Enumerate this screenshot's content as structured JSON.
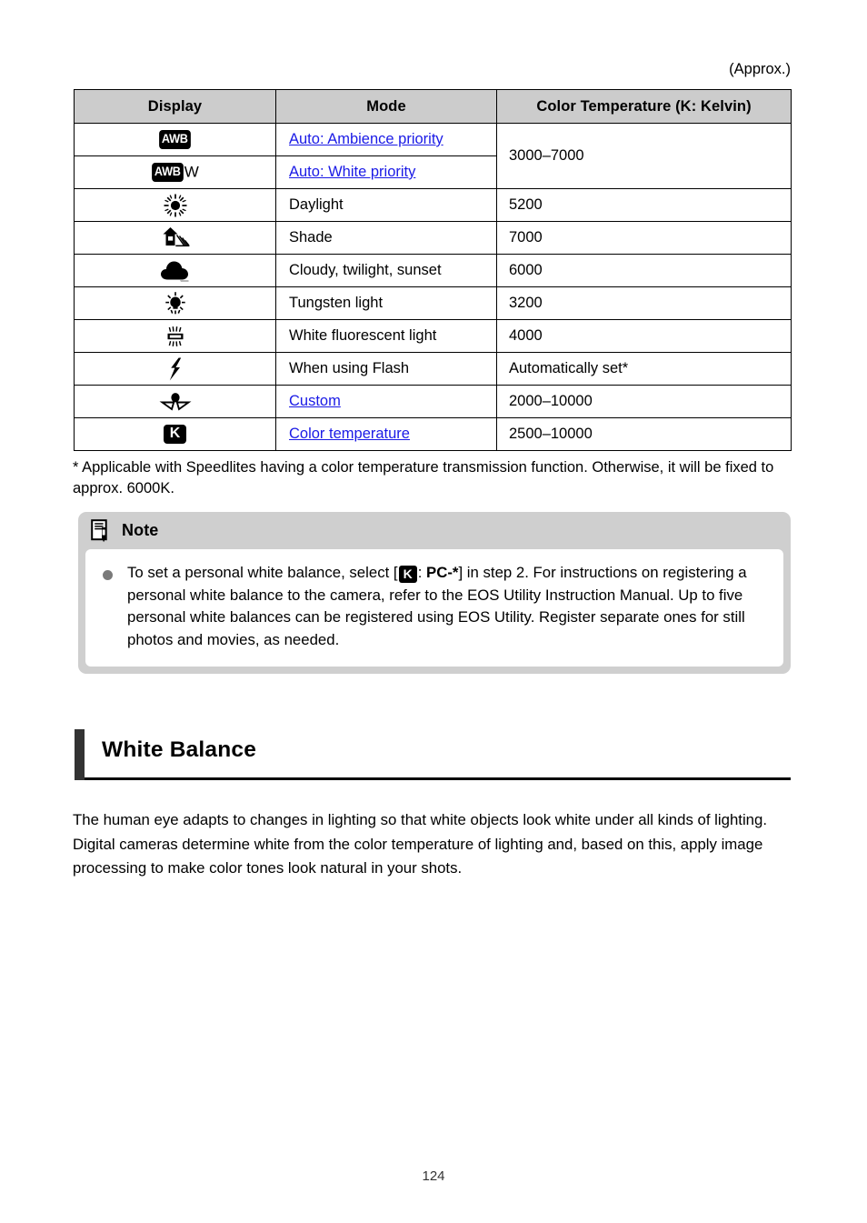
{
  "document": {
    "page_number": "124",
    "approx_label": "(Approx.)"
  },
  "table": {
    "headers": {
      "display": "Display",
      "mode": "Mode",
      "temperature": "Color Temperature (K: Kelvin)"
    },
    "rows": [
      {
        "icon": "awb-badge-icon",
        "mode": "Auto: Ambience priority",
        "mode_is_link": true,
        "temp": "3000–7000"
      },
      {
        "icon": "awb-w-badge-icon",
        "mode": "Auto: White priority",
        "mode_is_link": true,
        "temp": ""
      },
      {
        "icon": "daylight-sun-icon",
        "mode": "Daylight",
        "mode_is_link": false,
        "temp": "5200"
      },
      {
        "icon": "shade-house-icon",
        "mode": "Shade",
        "mode_is_link": false,
        "temp": "7000"
      },
      {
        "icon": "cloudy-cloud-icon",
        "mode": "Cloudy, twilight, sunset",
        "mode_is_link": false,
        "temp": "6000"
      },
      {
        "icon": "tungsten-bulb-icon",
        "mode": "Tungsten light",
        "mode_is_link": false,
        "temp": "3200"
      },
      {
        "icon": "fluorescent-tube-icon",
        "mode": "White fluorescent light",
        "mode_is_link": false,
        "temp": "4000"
      },
      {
        "icon": "flash-bolt-icon",
        "mode": "When using Flash",
        "mode_is_link": false,
        "temp": "Automatically set*"
      },
      {
        "icon": "custom-wb-icon",
        "mode": "Custom",
        "mode_is_link": true,
        "temp": "2000–10000"
      },
      {
        "icon": "kelvin-badge-icon",
        "mode": "Color temperature",
        "mode_is_link": true,
        "temp": "2500–10000"
      }
    ],
    "awb_badge_text": "AWB",
    "awb_w_suffix": "W",
    "kelvin_badge_text": "K"
  },
  "footnote": {
    "text": "* Applicable with Speedlites having a color temperature transmission function. Otherwise, it will be fixed to approx. 6000K."
  },
  "note": {
    "title": "Note",
    "icon": "note-document-pen-icon",
    "text_part1": "To set a personal white balance, select [",
    "inline_icon": "kelvin-badge-icon",
    "inline_icon_text": "K",
    "text_part2": ": ",
    "bold_code": "PC-*",
    "text_part3": "] in step 2. For instructions on registering a personal white balance to the camera, refer to the EOS Utility Instruction Manual. Up to five personal white balances can be registered using EOS Utility. Register separate ones for still photos and movies, as needed."
  },
  "section": {
    "title": "White Balance",
    "paragraph": "The human eye adapts to changes in lighting so that white objects look white under all kinds of lighting. Digital cameras determine white from the color temperature of lighting and, based on this, apply image processing to make color tones look natural in your shots."
  },
  "colors": {
    "link": "#1a1ae6",
    "table_header_bg": "#cccccc",
    "note_bg": "#cfcfcf",
    "section_bar": "#333333",
    "bullet": "#7a7a7a"
  }
}
